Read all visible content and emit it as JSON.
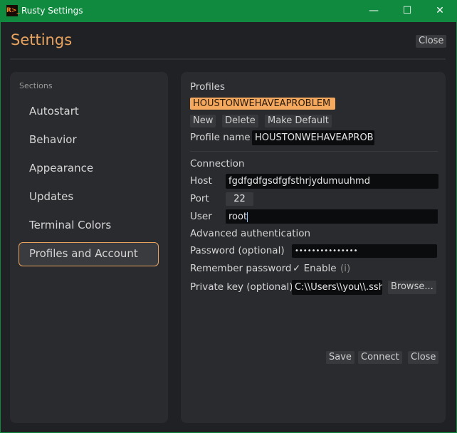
{
  "window": {
    "title": "Rusty Settings",
    "icon": "R>_",
    "controls": {
      "minimize": "—",
      "maximize": "☐",
      "close": "✕"
    }
  },
  "header": {
    "title": "Settings",
    "close_label": "Close"
  },
  "sidebar": {
    "heading": "Sections",
    "selected": "Profiles and Account",
    "items": [
      {
        "label": "Autostart"
      },
      {
        "label": "Behavior"
      },
      {
        "label": "Appearance"
      },
      {
        "label": "Updates"
      },
      {
        "label": "Terminal Colors"
      },
      {
        "label": "Profiles and Account"
      }
    ]
  },
  "profiles": {
    "heading": "Profiles",
    "selected_profile": "HOUSTONWEHAVEAPROBLEM",
    "new_label": "New",
    "delete_label": "Delete",
    "make_default_label": "Make Default",
    "name_label": "Profile name",
    "name_value": "HOUSTONWEHAVEAPROB"
  },
  "connection": {
    "heading": "Connection",
    "host_label": "Host",
    "host_value": "fgdfgdfgsdfgfsthrjydumuuhmd",
    "port_label": "Port",
    "port_value": "22",
    "user_label": "User",
    "user_value": "root"
  },
  "advanced": {
    "heading": "Advanced authentication",
    "password_label": "Password (optional)",
    "password_value": "•••••••••••••••",
    "remember_label": "Remember password",
    "remember_checked": true,
    "check_glyph": "✓",
    "enable_label": "Enable",
    "info_label": "(i)",
    "key_label": "Private key (optional)",
    "key_value": "C:\\\\Users\\\\you\\\\.ssh",
    "browse_label": "Browse..."
  },
  "footer": {
    "save_label": "Save",
    "connect_label": "Connect",
    "close_label": "Close"
  },
  "colors": {
    "accent": "#e8a35f",
    "titlebar": "#0f8a3f",
    "background": "#202124",
    "panel": "#2a2b2f"
  }
}
